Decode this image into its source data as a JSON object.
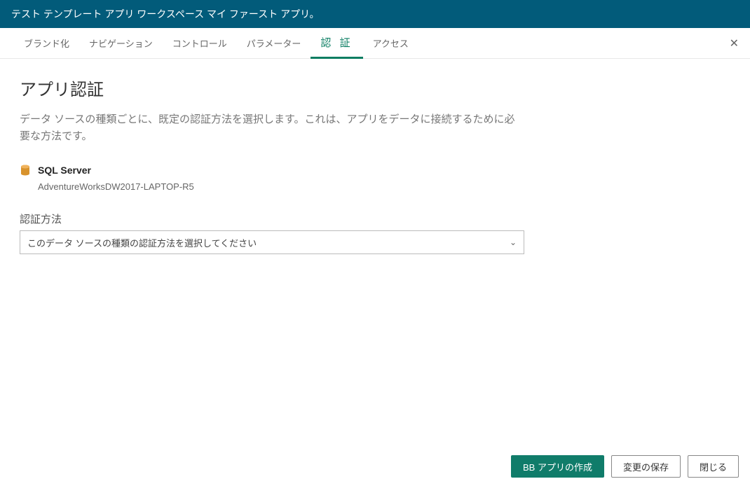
{
  "header": {
    "title": "テスト テンプレート アプリ ワークスペース マイ ファースト アプリ。"
  },
  "tabs": {
    "branding": "ブランド化",
    "navigation": "ナビゲーション",
    "control": "コントロール",
    "parameters": "パラメーター",
    "auth": "認 証",
    "access": "アクセス"
  },
  "page": {
    "title": "アプリ認証",
    "description": "データ ソースの種類ごとに、既定の認証方法を選択します。これは、アプリをデータに接続するために必要な方法です。"
  },
  "source": {
    "name": "SQL Server",
    "detail": "AdventureWorksDW2017-LAPTOP-R5"
  },
  "auth_method": {
    "label": "認証方法",
    "placeholder": "このデータ ソースの種類の認証方法を選択してください"
  },
  "footer": {
    "create": "BB アプリの作成",
    "save": "変更の保存",
    "close": "閉じる"
  }
}
